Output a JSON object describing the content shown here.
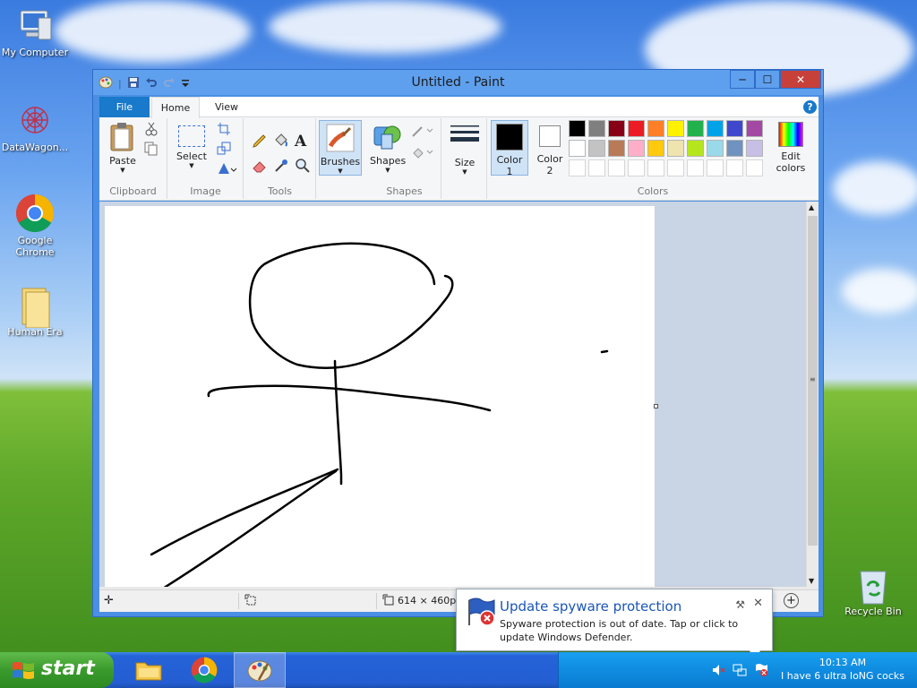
{
  "desktop": {
    "icons": [
      {
        "label": "My Computer"
      },
      {
        "label": "DataWagon..."
      },
      {
        "label": "Google Chrome"
      },
      {
        "label": "Human Era"
      },
      {
        "label": "Recycle Bin"
      }
    ]
  },
  "window": {
    "title": "Untitled - Paint",
    "controls": {
      "minimize": "─",
      "maximize": "☐",
      "close": "✕"
    }
  },
  "ribbon": {
    "tabs": [
      {
        "label": "File"
      },
      {
        "label": "Home"
      },
      {
        "label": "View"
      }
    ],
    "help": "?",
    "groups": {
      "clipboard": {
        "label": "Clipboard",
        "paste": "Paste"
      },
      "image": {
        "label": "Image",
        "select": "Select"
      },
      "tools": {
        "label": "Tools"
      },
      "brushes": {
        "label": "Brushes"
      },
      "shapes": {
        "label": "Shapes",
        "button": "Shapes"
      },
      "size": {
        "label": "Size"
      },
      "colors": {
        "label": "Colors",
        "color1_line1": "Color",
        "color1_line2": "1",
        "color2_line1": "Color",
        "color2_line2": "2",
        "edit_line1": "Edit",
        "edit_line2": "colors",
        "color1": "#000000",
        "color2": "#ffffff",
        "palette_row1": [
          "#000000",
          "#7f7f7f",
          "#880015",
          "#ed1c24",
          "#ff7f27",
          "#fff200",
          "#22b14c",
          "#00a2e8",
          "#3f48cc",
          "#a349a4"
        ],
        "palette_row2": [
          "#ffffff",
          "#c3c3c3",
          "#b97a57",
          "#ffaec9",
          "#ffc90e",
          "#efe4b0",
          "#b5e61d",
          "#99d9ea",
          "#7092be",
          "#c8bfe7"
        ]
      }
    }
  },
  "statusbar": {
    "canvas_size": "614 × 460px"
  },
  "notification": {
    "title": "Update spyware protection",
    "body": "Spyware protection is out of date. Tap or click to update Windows Defender."
  },
  "taskbar": {
    "start_label": "start",
    "clock_time": "10:13 AM",
    "clock_text": "I have 6 ultra IoNG cocks"
  }
}
